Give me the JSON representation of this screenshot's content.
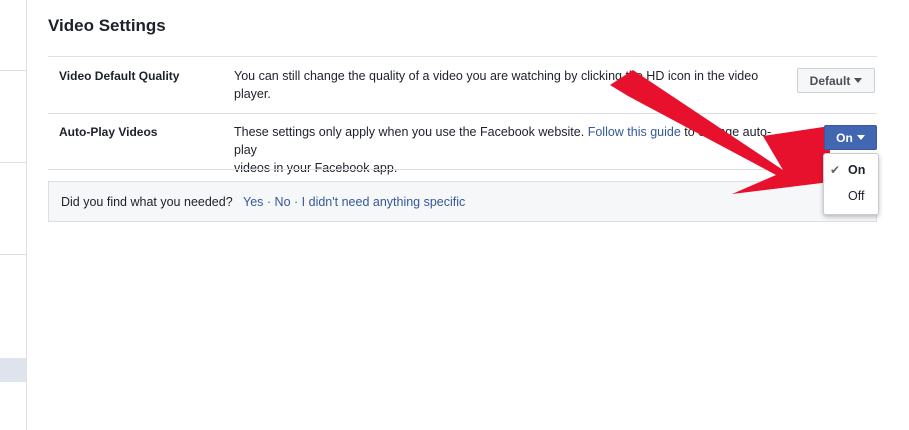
{
  "colors": {
    "accent": "#4267b2",
    "link": "#365899",
    "arrow": "#e8112d",
    "feedback_bg": "#f6f7f9"
  },
  "page": {
    "title": "Video Settings"
  },
  "settings": [
    {
      "label": "Video Default Quality",
      "description_line1": "You can still change the quality of a video you are watching by clicking the HD icon in the video",
      "description_line2": "player.",
      "control_value": "Default",
      "control_icon": "caret-down-icon"
    },
    {
      "label": "Auto-Play Videos",
      "description_prefix": "These settings only apply when you use the Facebook website.",
      "description_link": "Follow this guide",
      "description_suffix": "to change auto-play",
      "description_line2": "videos in your Facebook app.",
      "control_value": "On",
      "control_icon": "caret-down-icon"
    }
  ],
  "dropdown": {
    "options": [
      {
        "label": "On",
        "selected": true,
        "icon": "checkmark-icon",
        "check": "✔"
      },
      {
        "label": "Off",
        "selected": false
      }
    ]
  },
  "feedback": {
    "question": "Did you find what you needed?",
    "yes": "Yes",
    "no": "No",
    "not_needed": "I didn't need anything specific",
    "separator": "·"
  }
}
